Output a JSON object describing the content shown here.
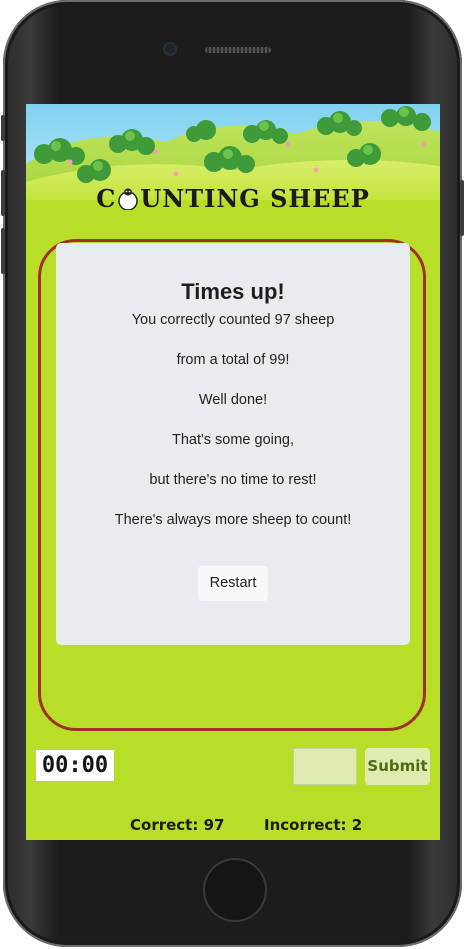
{
  "app": {
    "title_first": "C",
    "title_rest": "UNTING SHEEP"
  },
  "result": {
    "heading": "Times up!",
    "line1": "You correctly counted 97 sheep",
    "line2": "from a total of 99!",
    "line3": "Well done!",
    "line4": "That's some going,",
    "line5": "but there's no time to rest!",
    "line6": "There's always more sheep to count!",
    "restart_label": "Restart"
  },
  "controls": {
    "timer": "00:00",
    "answer_value": "",
    "submit_label": "Submit"
  },
  "score": {
    "correct_label": "Correct: 97",
    "incorrect_label": "Incorrect: 2"
  },
  "colors": {
    "background": "#b8de29",
    "frame_border": "#a0312a",
    "card": "#e8ecef",
    "submit_bg": "#e0ebb0",
    "submit_text": "#4e6a14"
  }
}
